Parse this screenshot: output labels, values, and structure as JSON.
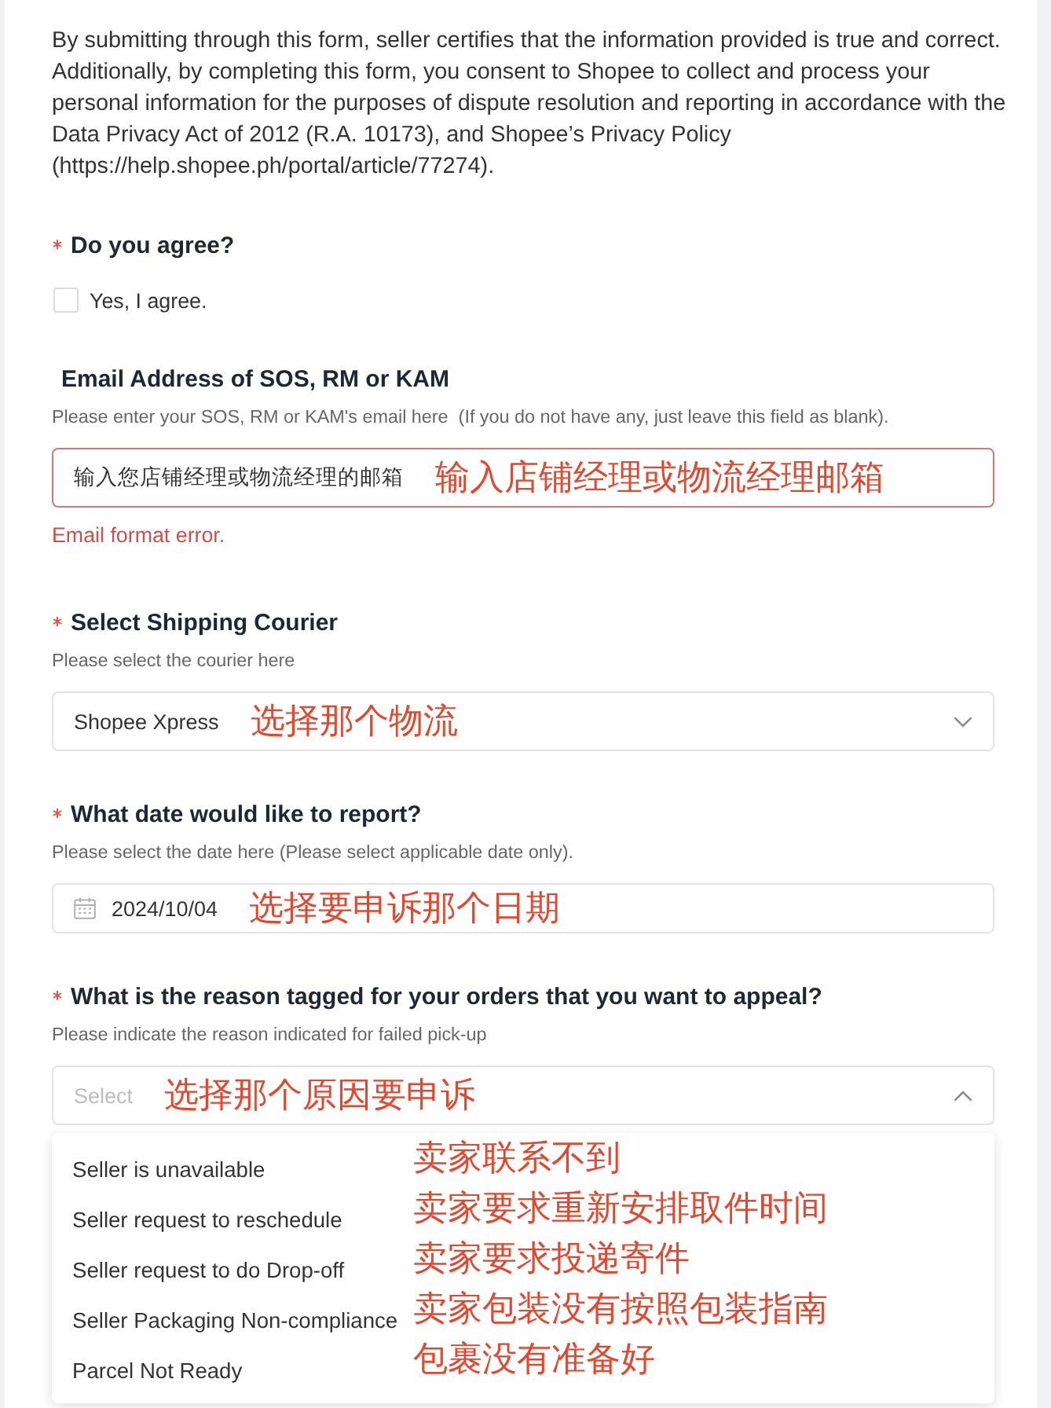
{
  "consent_text": "By submitting through this form, seller certifies that the information provided is true and correct. Additionally, by completing this form, you consent to Shopee to collect and process your personal information for the purposes of dispute resolution and reporting in accordance with the Data Privacy Act of 2012 (R.A. 10173), and Shopee’s Privacy Policy (https://help.shopee.ph/portal/article/77274).",
  "agreement": {
    "label": "Do you agree?",
    "required": true,
    "option": {
      "label": "Yes, I agree.",
      "checked": false
    }
  },
  "fields": [
    {
      "kind": "text",
      "label": "Email Address of SOS, RM or KAM",
      "required": false,
      "hint": "Please enter your SOS, RM or KAM's email here  (If you do not have any, just leave this field as blank).",
      "value": "输入您店铺经理或物流经理的邮箱",
      "invalid": true,
      "error": "Email format error.",
      "annotation": "输入店铺经理或物流经理邮箱"
    },
    {
      "kind": "select",
      "label": "Select Shipping Courier",
      "required": true,
      "hint": "Please select the courier here",
      "value": "Shopee Xpress",
      "expanded": false,
      "annotation": "选择那个物流"
    },
    {
      "kind": "date",
      "label": "What date would like to report?",
      "required": true,
      "hint": "Please select the date here (Please select applicable date only).",
      "value": "2024/10/04",
      "annotation": "选择要申诉那个日期"
    },
    {
      "kind": "select",
      "label": "What is the reason tagged for your orders that you want to appeal?",
      "required": true,
      "hint": "Please indicate the reason indicated for failed pick-up",
      "placeholder": "Select",
      "expanded": true,
      "annotation": "选择那个原因要申诉",
      "options": [
        {
          "label": "Seller is unavailable",
          "selected": false,
          "annotation": "卖家联系不到"
        },
        {
          "label": "Seller request to reschedule",
          "selected": false,
          "annotation": "卖家要求重新安排取件时间"
        },
        {
          "label": "Seller request to do Drop-off",
          "selected": false,
          "annotation": "卖家要求投递寄件"
        },
        {
          "label": "Seller Packaging Non-compliance",
          "selected": false,
          "annotation": "卖家包装没有按照包装指南"
        },
        {
          "label": "Parcel Not Ready",
          "selected": false,
          "annotation": "包裹没有准备好"
        }
      ]
    }
  ]
}
